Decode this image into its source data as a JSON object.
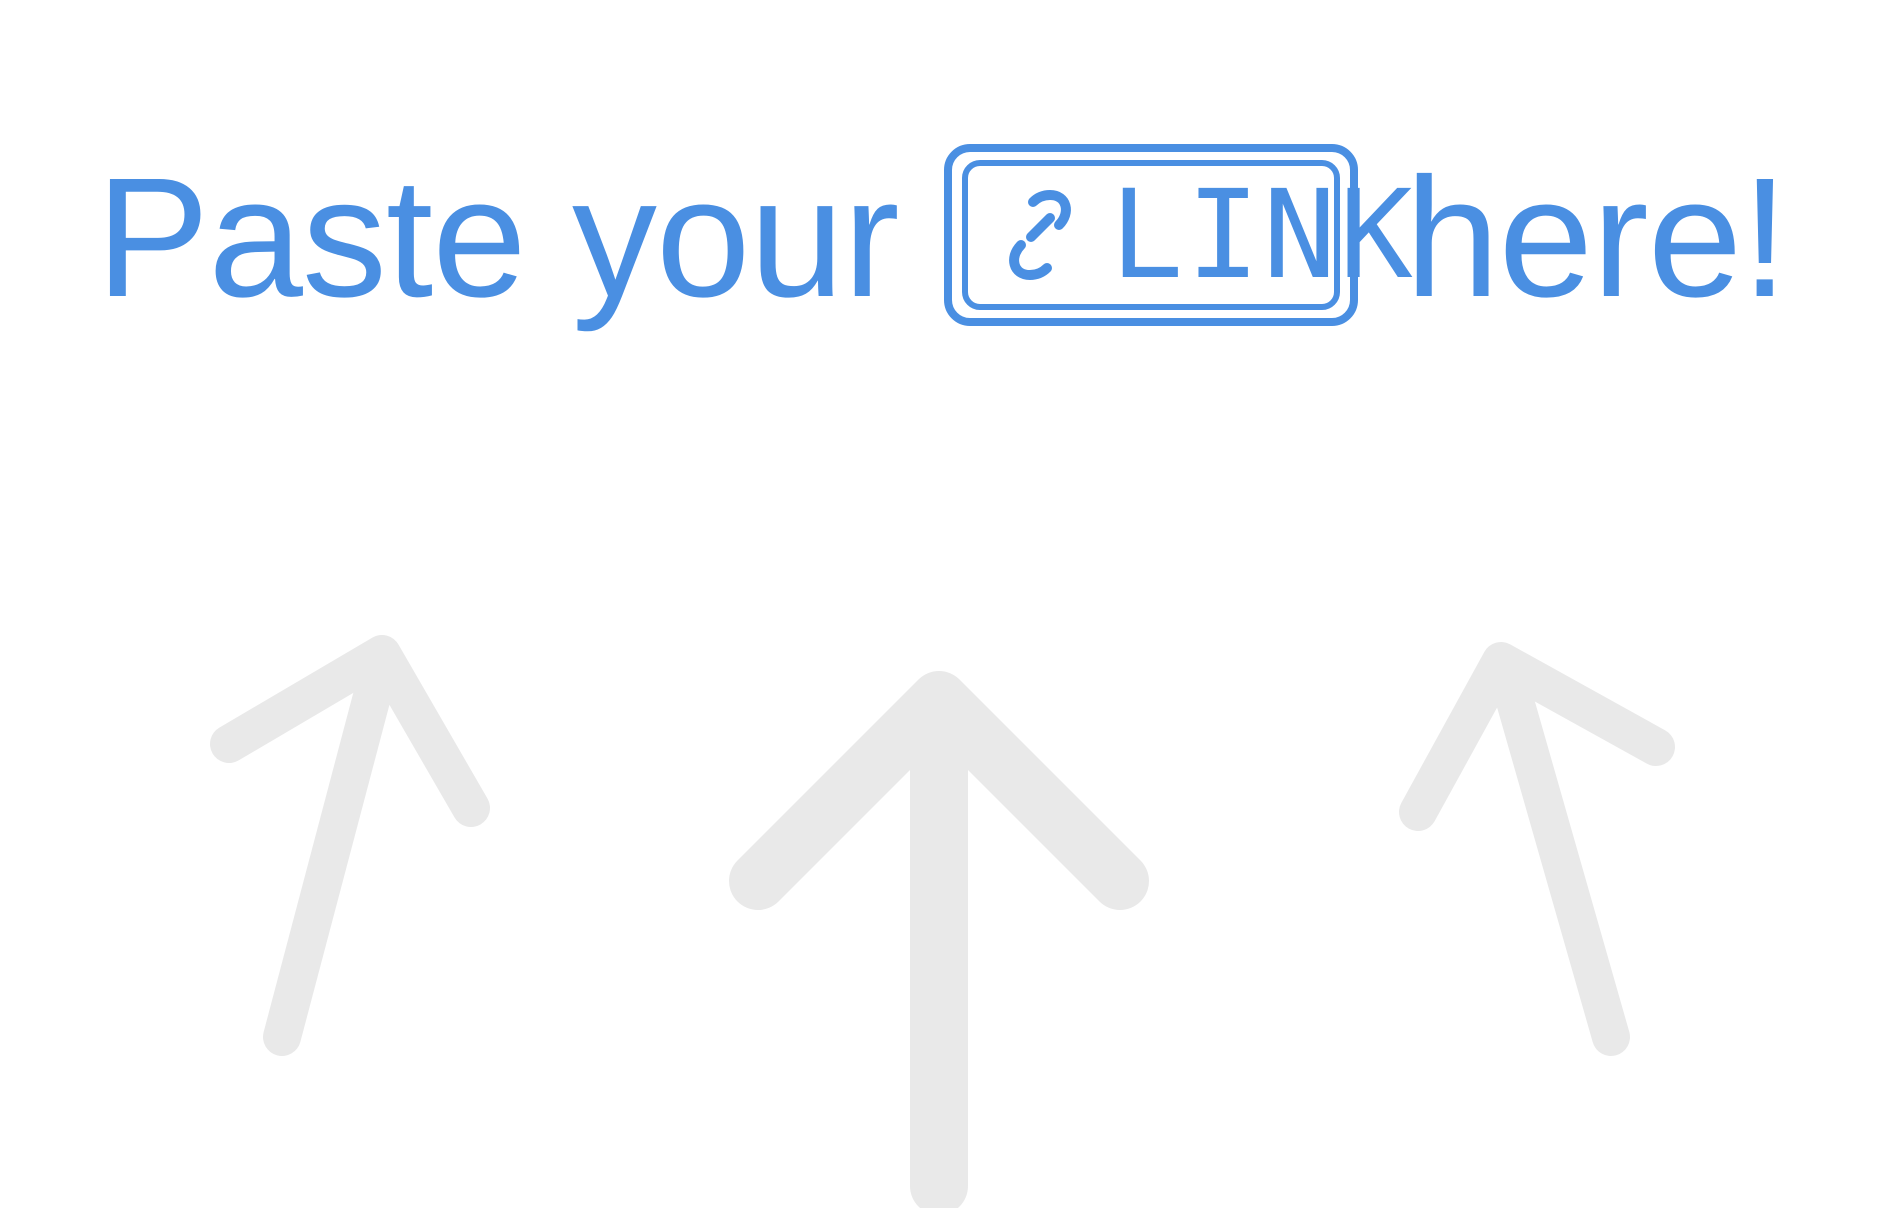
{
  "headline": {
    "before_badge": "Paste your",
    "after_badge": "here!"
  },
  "link_badge": {
    "icon": "link-icon",
    "label": "LINK"
  },
  "arrows": {
    "count": 3,
    "color": "#e9e9e9",
    "icon": "up-arrow-icon"
  },
  "colors": {
    "accent": "#4a8fe2",
    "background": "#ffffff"
  }
}
